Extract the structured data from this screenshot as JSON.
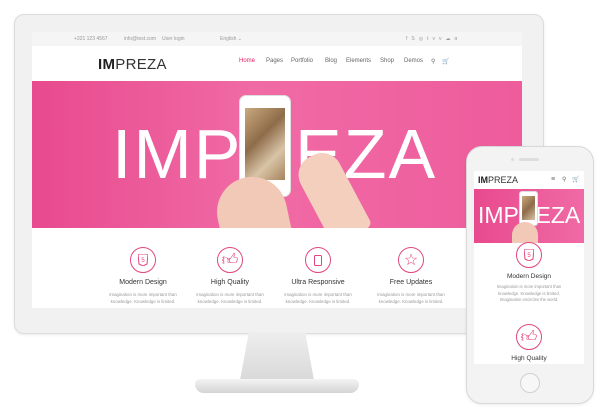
{
  "topbar": {
    "phone": "+321 123 4567",
    "email": "info@test.com",
    "login": "User login",
    "language": "English",
    "social_icons": [
      "facebook-icon",
      "skype-icon",
      "instagram-icon",
      "twitter-icon",
      "vk-icon",
      "vimeo-icon",
      "soundcloud-icon",
      "tripadvisor-icon"
    ]
  },
  "header": {
    "logo_bold": "IM",
    "logo_rest": "PREZA",
    "nav": [
      "Home",
      "Pages",
      "Portfolio",
      "Blog",
      "Elements",
      "Shop",
      "Demos"
    ],
    "active_nav": "Home"
  },
  "hero": {
    "word": "IMPREZA"
  },
  "features": [
    {
      "title": "Modern Design",
      "desc1": "Imagination is more important than",
      "desc2": "knowledge. Knowledge is limited.",
      "icon": "html5-icon"
    },
    {
      "title": "High Quality",
      "desc1": "Imagination is more important than",
      "desc2": "knowledge. Knowledge is limited.",
      "icon": "thumbs-up-icon"
    },
    {
      "title": "Ultra Responsive",
      "desc1": "Imagination is more important than",
      "desc2": "knowledge. Knowledge is limited.",
      "icon": "tablet-icon"
    },
    {
      "title": "Free Updates",
      "desc1": "Imagination is more important than",
      "desc2": "knowledge. Knowledge is limited.",
      "icon": "star-icon"
    }
  ],
  "mobile": {
    "logo_bold": "IM",
    "logo_rest": "PREZA",
    "hero_word": "IMPREZA",
    "features": [
      {
        "title": "Modern Design",
        "desc1": "Imagination is more important than",
        "desc2": "knowledge. Knowledge is limited.",
        "desc3": "Imagination encircles the world."
      },
      {
        "title": "High Quality"
      }
    ]
  },
  "colors": {
    "accent": "#e2457f",
    "hero": "#ee5c9c"
  }
}
